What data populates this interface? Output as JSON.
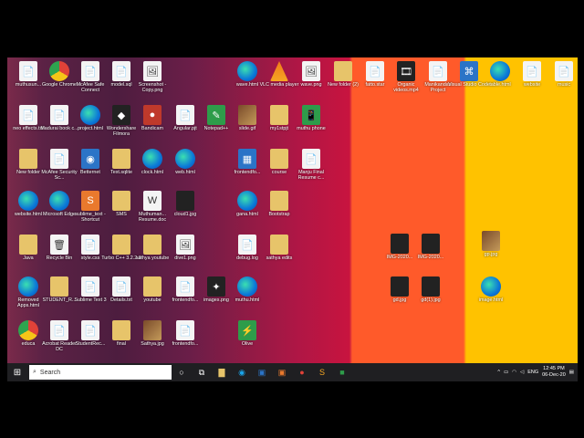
{
  "desktop": {
    "icons": [
      {
        "label": "muthusun...",
        "kind": "doc",
        "glyph": "📄"
      },
      {
        "label": "Google Chrome",
        "kind": "chrome",
        "glyph": ""
      },
      {
        "label": "McAfee Safe Connect",
        "kind": "doc",
        "glyph": "📄"
      },
      {
        "label": "model.sql",
        "kind": "doc",
        "glyph": "📄"
      },
      {
        "label": "Screenshot - Copy.png",
        "kind": "doc",
        "glyph": "🖼"
      },
      {
        "label": "wave.html",
        "kind": "edge",
        "glyph": ""
      },
      {
        "label": "VLC media player",
        "kind": "vlc",
        "glyph": ""
      },
      {
        "label": "wave.png",
        "kind": "doc",
        "glyph": "🖼"
      },
      {
        "label": "New folder (2)",
        "kind": "folder",
        "glyph": ""
      },
      {
        "label": "fatto.star",
        "kind": "doc",
        "glyph": "📄"
      },
      {
        "label": "Organic videos.mp4",
        "kind": "dark",
        "glyph": "🎞"
      },
      {
        "label": "Manikandan Project",
        "kind": "doc",
        "glyph": "📄"
      },
      {
        "label": "Visual Studio Code",
        "kind": "blue",
        "glyph": "⌘"
      },
      {
        "label": "table.html",
        "kind": "edge",
        "glyph": ""
      },
      {
        "label": "website",
        "kind": "doc",
        "glyph": "📄"
      },
      {
        "label": "music",
        "kind": "doc",
        "glyph": "📄"
      },
      {
        "label": "neo effects.txt",
        "kind": "doc",
        "glyph": "📄"
      },
      {
        "label": "Madurai book c...",
        "kind": "doc",
        "glyph": "📄"
      },
      {
        "label": "project.html",
        "kind": "edge",
        "glyph": ""
      },
      {
        "label": "Wondershare Filmora",
        "kind": "dark",
        "glyph": "◆"
      },
      {
        "label": "Bandicam",
        "kind": "red",
        "glyph": "●"
      },
      {
        "label": "Angular.pjt",
        "kind": "doc",
        "glyph": "📄"
      },
      {
        "label": "Notepad++",
        "kind": "green",
        "glyph": "✎"
      },
      {
        "label": "slide.gif",
        "kind": "img",
        "glyph": ""
      },
      {
        "label": "my1stpjt",
        "kind": "folder",
        "glyph": ""
      },
      {
        "label": "muthu phone",
        "kind": "green",
        "glyph": "📱"
      },
      {
        "label": "New folder",
        "kind": "folder",
        "glyph": ""
      },
      {
        "label": "McAfee Security Sc...",
        "kind": "doc",
        "glyph": "📄"
      },
      {
        "label": "Betternet",
        "kind": "blue",
        "glyph": "◉"
      },
      {
        "label": "Text.sqlite",
        "kind": "folder",
        "glyph": ""
      },
      {
        "label": "clock.html",
        "kind": "edge",
        "glyph": ""
      },
      {
        "label": "web.html",
        "kind": "edge",
        "glyph": ""
      },
      {
        "label": "frontendfo...",
        "kind": "blue",
        "glyph": "▦"
      },
      {
        "label": "course",
        "kind": "folder",
        "glyph": ""
      },
      {
        "label": "Manju Final Resume c...",
        "kind": "doc",
        "glyph": "📄"
      },
      {
        "label": "website.html",
        "kind": "edge",
        "glyph": ""
      },
      {
        "label": "Microsoft Edge",
        "kind": "edge",
        "glyph": ""
      },
      {
        "label": "sublime_text - Shortcut",
        "kind": "orange",
        "glyph": "S"
      },
      {
        "label": "SMS",
        "kind": "folder",
        "glyph": ""
      },
      {
        "label": "Muthuman... Resume.doc",
        "kind": "doc",
        "glyph": "W"
      },
      {
        "label": "cloud1.jpg",
        "kind": "dark",
        "glyph": ""
      },
      {
        "label": "gana.html",
        "kind": "edge",
        "glyph": ""
      },
      {
        "label": "Bootstrap",
        "kind": "folder",
        "glyph": ""
      },
      {
        "label": "Java",
        "kind": "folder",
        "glyph": ""
      },
      {
        "label": "Recycle Bin",
        "kind": "doc",
        "glyph": "🗑"
      },
      {
        "label": "style.css",
        "kind": "doc",
        "glyph": "📄"
      },
      {
        "label": "Turbo C++ 3.2.2.0",
        "kind": "folder",
        "glyph": ""
      },
      {
        "label": "sathya youtube",
        "kind": "folder",
        "glyph": ""
      },
      {
        "label": "dive1.png",
        "kind": "doc",
        "glyph": "🖼"
      },
      {
        "label": "debug.log",
        "kind": "doc",
        "glyph": "📄"
      },
      {
        "label": "sathya edits",
        "kind": "folder",
        "glyph": ""
      },
      {
        "label": "Removed Apps.html",
        "kind": "edge",
        "glyph": ""
      },
      {
        "label": "STUDENT_R...",
        "kind": "folder",
        "glyph": ""
      },
      {
        "label": "Sublime Text 3",
        "kind": "doc",
        "glyph": "📄"
      },
      {
        "label": "Details.txt",
        "kind": "doc",
        "glyph": "📄"
      },
      {
        "label": "youtube",
        "kind": "folder",
        "glyph": ""
      },
      {
        "label": "frontendfo...",
        "kind": "doc",
        "glyph": "📄"
      },
      {
        "label": "images.png",
        "kind": "dark",
        "glyph": "✦"
      },
      {
        "label": "muthu.html",
        "kind": "edge",
        "glyph": ""
      },
      {
        "label": "educa",
        "kind": "chrome",
        "glyph": ""
      },
      {
        "label": "Acrobat Reader DC",
        "kind": "doc",
        "glyph": "📄"
      },
      {
        "label": "StudentRec...",
        "kind": "doc",
        "glyph": "📄"
      },
      {
        "label": "final",
        "kind": "folder",
        "glyph": ""
      },
      {
        "label": "Sathya.jpg",
        "kind": "img",
        "glyph": ""
      },
      {
        "label": "frontendfo...",
        "kind": "doc",
        "glyph": "📄"
      },
      {
        "label": "Olive",
        "kind": "green",
        "glyph": "⚡"
      },
      {
        "label": "IMG-2020...",
        "kind": "dark",
        "glyph": ""
      },
      {
        "label": "IMG-2020...",
        "kind": "dark",
        "glyph": ""
      },
      {
        "label": "gp.jpg",
        "kind": "img",
        "glyph": ""
      },
      {
        "label": "gd.jpg",
        "kind": "dark",
        "glyph": ""
      },
      {
        "label": "gd(1).jpg",
        "kind": "dark",
        "glyph": ""
      },
      {
        "label": "image.html",
        "kind": "edge",
        "glyph": ""
      }
    ]
  },
  "taskbar": {
    "search_placeholder": "Search",
    "apps": [
      "task-view",
      "file-explorer",
      "edge",
      "store",
      "app-orange",
      "record",
      "sublime",
      "green-app"
    ],
    "lang": "ENG",
    "time": "12:45 PM",
    "date": "06-Dec-20"
  }
}
